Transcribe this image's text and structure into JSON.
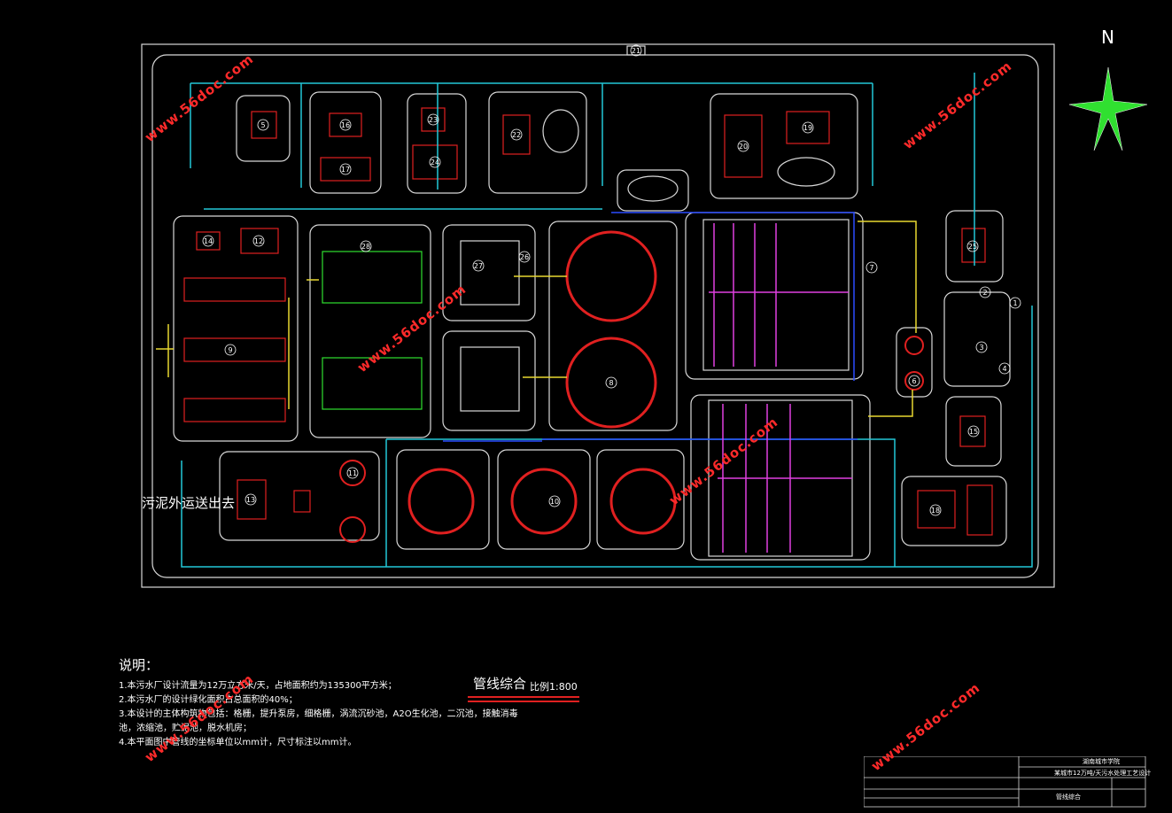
{
  "watermark": "www.56doc.com",
  "north_label": "N",
  "sludge_label": "污泥外运送出去",
  "pipeline": {
    "title": "管线综合",
    "scale": "比例1:800"
  },
  "notes": {
    "heading": "说明：",
    "lines": [
      "1.本污水厂设计流量为12万立方米/天，占地面积约为135300平方米；",
      "2.本污水厂的设计绿化面积占总面积的40%；",
      "3.本设计的主体构筑物包括：格栅，提升泵房，细格栅，涡流沉砂池，A2O生化池，二沉池，接触消毒",
      "池，浓缩池，贮泥池，脱水机房；",
      "4.本平面图中管线的坐标单位以mm计，尺寸标注以mm计。"
    ]
  },
  "title_block": {
    "school": "湖南城市学院",
    "project": "某城市12万吨/天污水处理工艺设计",
    "drawing": "管线综合"
  },
  "colors": {
    "outline": "#d8d8d8",
    "pipe_cyan": "#22c8d8",
    "pipe_yellow": "#e8d830",
    "pipe_blue": "#2a4cff",
    "magenta": "#e040e0",
    "red": "#e02020",
    "green": "#30e030"
  },
  "unit_labels": [
    "1",
    "2",
    "3",
    "4",
    "5",
    "6",
    "7",
    "8",
    "9",
    "10",
    "11",
    "12",
    "13",
    "14",
    "15",
    "16",
    "17",
    "18",
    "19",
    "20",
    "21",
    "22",
    "23",
    "24",
    "25",
    "26",
    "27",
    "28"
  ]
}
